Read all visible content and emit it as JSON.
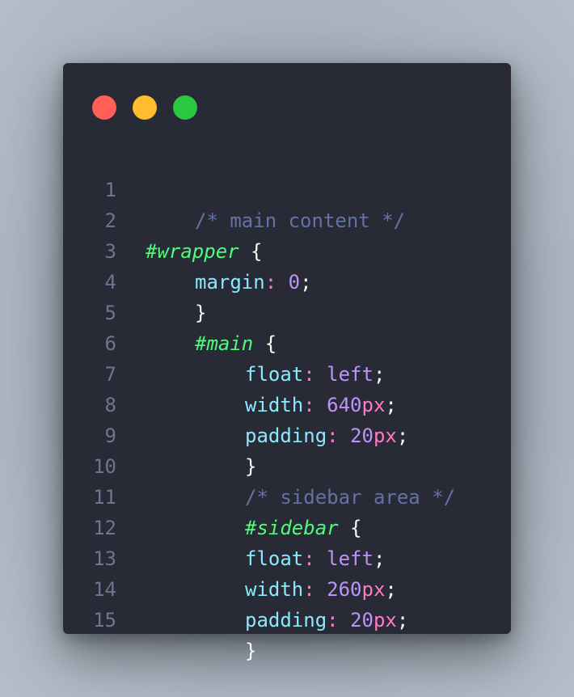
{
  "window": {
    "controls": [
      {
        "name": "close",
        "color": "#ff5f57"
      },
      {
        "name": "minimize",
        "color": "#febc2e"
      },
      {
        "name": "zoom",
        "color": "#28c840"
      }
    ]
  },
  "code": {
    "lines": [
      {
        "n": "1",
        "text": "/* main content */"
      },
      {
        "n": "2",
        "selector": "#wrapper",
        "brace": "{"
      },
      {
        "n": "3",
        "prop": "margin",
        "colon": ":",
        "value": "0",
        "semi": ";"
      },
      {
        "n": "4",
        "brace": "}"
      },
      {
        "n": "5",
        "selector": "#main",
        "brace": "{"
      },
      {
        "n": "6",
        "prop": "float",
        "colon": ":",
        "value": "left",
        "semi": ";"
      },
      {
        "n": "7",
        "prop": "width",
        "colon": ":",
        "value": "640",
        "unit": "px",
        "semi": ";"
      },
      {
        "n": "8",
        "prop": "padding",
        "colon": ":",
        "value": "20",
        "unit": "px",
        "semi": ";"
      },
      {
        "n": "9",
        "brace": "}"
      },
      {
        "n": "10",
        "text": "/* sidebar area */"
      },
      {
        "n": "11",
        "selector": "#sidebar",
        "brace": "{"
      },
      {
        "n": "12",
        "prop": "float",
        "colon": ":",
        "value": "left",
        "semi": ";"
      },
      {
        "n": "13",
        "prop": "width",
        "colon": ":",
        "value": "260",
        "unit": "px",
        "semi": ";"
      },
      {
        "n": "14",
        "prop": "padding",
        "colon": ":",
        "value": "20",
        "unit": "px",
        "semi": ";"
      },
      {
        "n": "15",
        "brace": "}"
      }
    ]
  }
}
